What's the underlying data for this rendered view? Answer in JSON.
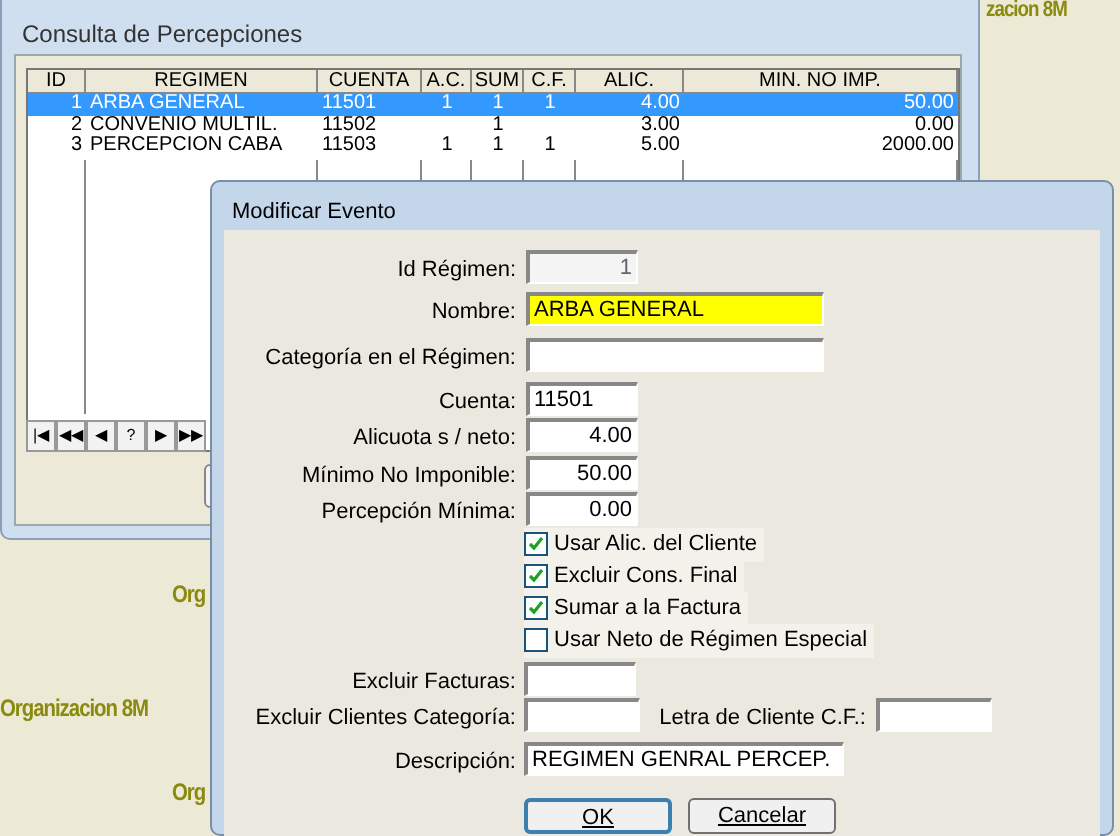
{
  "background": {
    "watermarks": [
      {
        "text": "zacion 8M"
      },
      {
        "text": "Org"
      },
      {
        "text": "Organizacion 8M"
      },
      {
        "text": "Org"
      }
    ]
  },
  "consulta_window": {
    "title": "Consulta de Percepciones",
    "table": {
      "columns": [
        "ID",
        "REGIMEN",
        "CUENTA",
        "A.C.",
        "SUM",
        "C.F.",
        "ALIC.",
        "MIN. NO IMP."
      ],
      "rows": [
        {
          "cells": [
            "1",
            "ARBA GENERAL",
            "11501",
            "1",
            "1",
            "1",
            "4.00",
            "50.00"
          ],
          "selected": true
        },
        {
          "cells": [
            "2",
            "CONVENIO MULTIL.",
            "11502",
            "",
            "1",
            "",
            "3.00",
            "0.00"
          ],
          "selected": false
        },
        {
          "cells": [
            "3",
            "PERCEPCION CABA",
            "11503",
            "1",
            "1",
            "1",
            "5.00",
            "2000.00"
          ],
          "selected": false
        }
      ]
    },
    "navigator": [
      "|◀",
      "◀◀",
      "◀",
      "?",
      "▶",
      "▶▶"
    ]
  },
  "dialog": {
    "title": "Modificar Evento",
    "fields": [
      {
        "label": "Id Régimen:",
        "value": "1",
        "disabled": true
      },
      {
        "label": "Nombre:",
        "value": "ARBA GENERAL",
        "highlighted": true
      },
      {
        "label": "Categoría en el Régimen:"
      },
      {
        "label": "Cuenta:",
        "value": "11501"
      },
      {
        "label": "Alicuota s / neto:",
        "value": "4.00"
      },
      {
        "label": "Mínimo No Imponible:",
        "value": "50.00"
      },
      {
        "label": "Percepción Mínima:",
        "value": "0.00"
      }
    ],
    "checkboxes": [
      {
        "label": "Usar Alic. del Cliente",
        "checked": true
      },
      {
        "label": "Excluir Cons. Final",
        "checked": true
      },
      {
        "label": "Sumar a la Factura",
        "checked": true
      },
      {
        "label": "Usar Neto de Régimen Especial",
        "checked": false
      }
    ],
    "excluir_facturas": {
      "label": "Excluir Facturas:"
    },
    "excluir_clientes": {
      "label": "Excluir Clientes Categoría:"
    },
    "letra_cliente": {
      "label": "Letra de Cliente C.F.:"
    },
    "descripcion": {
      "label": "Descripción:",
      "value": "REGIMEN GENRAL PERCEP."
    },
    "buttons": [
      {
        "label": "OK",
        "default": true
      },
      {
        "label": "Cancelar",
        "default": false
      }
    ]
  }
}
